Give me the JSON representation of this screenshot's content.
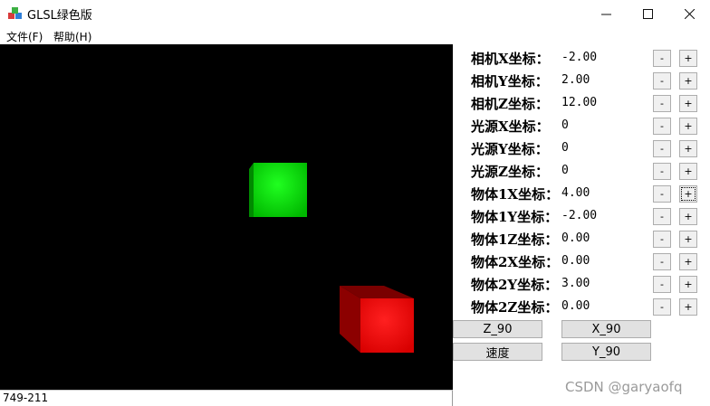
{
  "window": {
    "title": "GLSL绿色版",
    "minimize_glyph": "—",
    "maximize_glyph": "☐",
    "close_glyph": "✕"
  },
  "menu": {
    "items": [
      {
        "label": "文件(F)"
      },
      {
        "label": "帮助(H)"
      }
    ]
  },
  "status": {
    "text": "749-211"
  },
  "params": [
    {
      "label": "相机X坐标：",
      "value": "-2.00"
    },
    {
      "label": "相机Y坐标：",
      "value": "2.00"
    },
    {
      "label": "相机Z坐标：",
      "value": "12.00"
    },
    {
      "label": "光源X坐标：",
      "value": "0"
    },
    {
      "label": "光源Y坐标：",
      "value": "0"
    },
    {
      "label": "光源Z坐标：",
      "value": "0"
    },
    {
      "label": "物体1X坐标：",
      "value": "4.00"
    },
    {
      "label": "物体1Y坐标：",
      "value": "-2.00"
    },
    {
      "label": "物体1Z坐标：",
      "value": "0.00"
    },
    {
      "label": "物体2X坐标：",
      "value": "0.00"
    },
    {
      "label": "物体2Y坐标：",
      "value": "3.00"
    },
    {
      "label": "物体2Z坐标：",
      "value": "0.00"
    }
  ],
  "step_buttons": {
    "minus_label": "-",
    "plus_label": "+"
  },
  "actions": {
    "z90": "Z_90",
    "x90": "X_90",
    "speed": "速度",
    "y90": "Y_90"
  },
  "scene": {
    "background": "#000000",
    "cube1_color": "#00e000",
    "cube2_color": "#ff0000"
  },
  "watermark": "CSDN @garyaofq"
}
